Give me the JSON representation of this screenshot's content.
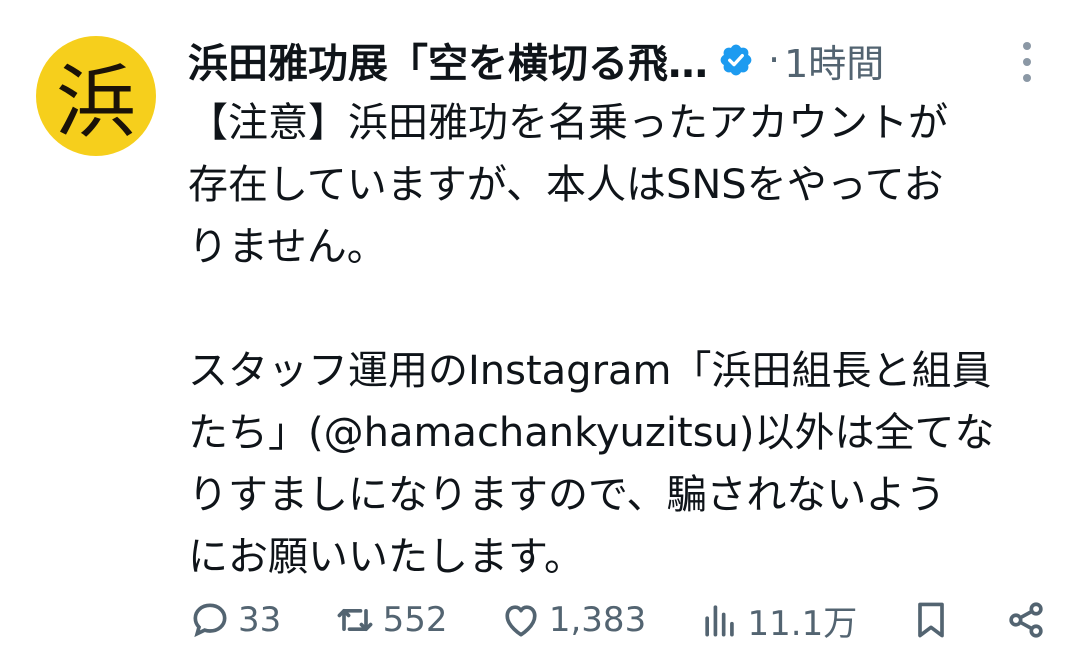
{
  "author": {
    "avatar_char": "浜",
    "display_name": "浜田雅功展「空を横切る飛…",
    "separator": "·",
    "time_ago": "1時間"
  },
  "tweet": {
    "lines": [
      "【注意】浜田雅功を名乗ったアカウントが",
      "存在していますが、本人はSNSをやってお",
      "りません。",
      "",
      "スタッフ運用のInstagram「浜田組長と組員",
      "たち」(@hamachankyuzitsu)以外は全てな",
      "りすましになりますので、騙されないよう",
      "にお願いいたします。"
    ]
  },
  "actions": {
    "replies": "33",
    "retweets": "552",
    "likes": "1,383",
    "views": "11.1万"
  },
  "colors": {
    "avatar_bg": "#f6cf1c",
    "verified": "#1d9bf0",
    "muted": "#536471"
  }
}
